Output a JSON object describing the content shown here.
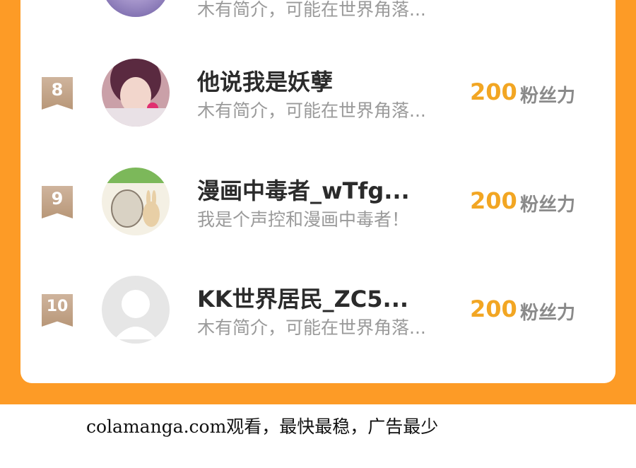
{
  "rows": [
    {
      "desc": "木有简介，可能在世界角落..."
    },
    {
      "rank": "8",
      "name": "他说我是妖孽",
      "desc": "木有简介，可能在世界角落...",
      "points": "200",
      "points_label": "粉丝力"
    },
    {
      "rank": "9",
      "name": "漫画中毒者_wTfg...",
      "desc": "我是个声控和漫画中毒者！",
      "points": "200",
      "points_label": "粉丝力"
    },
    {
      "rank": "10",
      "name": "KK世界居民_ZC5...",
      "desc": "木有简介，可能在世界角落...",
      "points": "200",
      "points_label": "粉丝力"
    }
  ],
  "footer": "colamanga.com观看，最快最稳，广告最少",
  "colors": {
    "accent": "#fd9b26",
    "points": "#f2a623",
    "badge": "#c4a68a"
  }
}
